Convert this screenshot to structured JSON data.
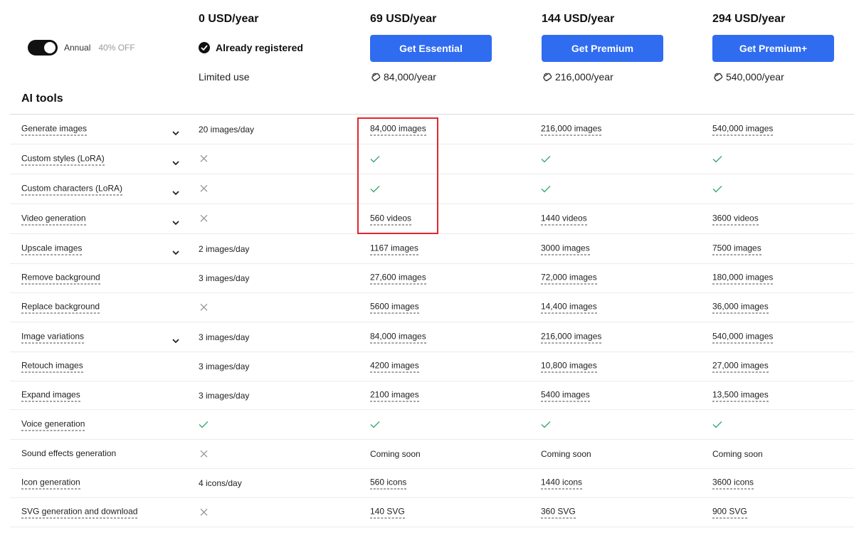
{
  "billing": {
    "toggle_label": "Annual",
    "discount": "40% OFF"
  },
  "plans": [
    {
      "price": "0 USD/year",
      "registered": "Already registered",
      "usage": "Limited use"
    },
    {
      "price": "69 USD/year",
      "button": "Get Essential",
      "credits": "84,000/year"
    },
    {
      "price": "144 USD/year",
      "button": "Get Premium",
      "credits": "216,000/year"
    },
    {
      "price": "294 USD/year",
      "button": "Get Premium+",
      "credits": "540,000/year"
    }
  ],
  "section": {
    "title": "AI tools"
  },
  "colors": {
    "button": "#2f6cf0",
    "check": "#3aa870",
    "cross": "#9a9a9a",
    "highlight": "#e3262b"
  },
  "rows": [
    {
      "label": "Generate images",
      "expandable": true,
      "cells": [
        "20 images/day",
        "84,000 images",
        "216,000 images",
        "540,000 images"
      ]
    },
    {
      "label": "Custom styles (LoRA)",
      "expandable": true,
      "cells": [
        "cross",
        "check",
        "check",
        "check"
      ]
    },
    {
      "label": "Custom characters (LoRA)",
      "expandable": true,
      "cells": [
        "cross",
        "check",
        "check",
        "check"
      ]
    },
    {
      "label": "Video generation",
      "expandable": true,
      "cells": [
        "cross",
        "560 videos",
        "1440 videos",
        "3600 videos"
      ]
    },
    {
      "label": "Upscale images",
      "expandable": true,
      "cells": [
        "2 images/day",
        "1167 images",
        "3000 images",
        "7500 images"
      ]
    },
    {
      "label": "Remove background",
      "expandable": false,
      "cells": [
        "3 images/day",
        "27,600 images",
        "72,000 images",
        "180,000 images"
      ]
    },
    {
      "label": "Replace background",
      "expandable": false,
      "cells": [
        "cross",
        "5600 images",
        "14,400 images",
        "36,000 images"
      ]
    },
    {
      "label": "Image variations",
      "expandable": true,
      "cells": [
        "3 images/day",
        "84,000 images",
        "216,000 images",
        "540,000 images"
      ]
    },
    {
      "label": "Retouch images",
      "expandable": false,
      "cells": [
        "3 images/day",
        "4200 images",
        "10,800 images",
        "27,000 images"
      ]
    },
    {
      "label": "Expand images",
      "expandable": false,
      "cells": [
        "3 images/day",
        "2100 images",
        "5400 images",
        "13,500 images"
      ]
    },
    {
      "label": "Voice generation",
      "expandable": false,
      "cells": [
        "check",
        "check",
        "check",
        "check"
      ]
    },
    {
      "label": "Sound effects generation",
      "expandable": false,
      "plain": true,
      "cells": [
        "cross",
        "Coming soon",
        "Coming soon",
        "Coming soon"
      ]
    },
    {
      "label": "Icon generation",
      "expandable": false,
      "cells": [
        "4 icons/day",
        "560 icons",
        "1440 icons",
        "3600 icons"
      ]
    },
    {
      "label": "SVG generation and download",
      "expandable": false,
      "cells": [
        "cross",
        "140 SVG",
        "360 SVG",
        "900 SVG"
      ]
    }
  ]
}
